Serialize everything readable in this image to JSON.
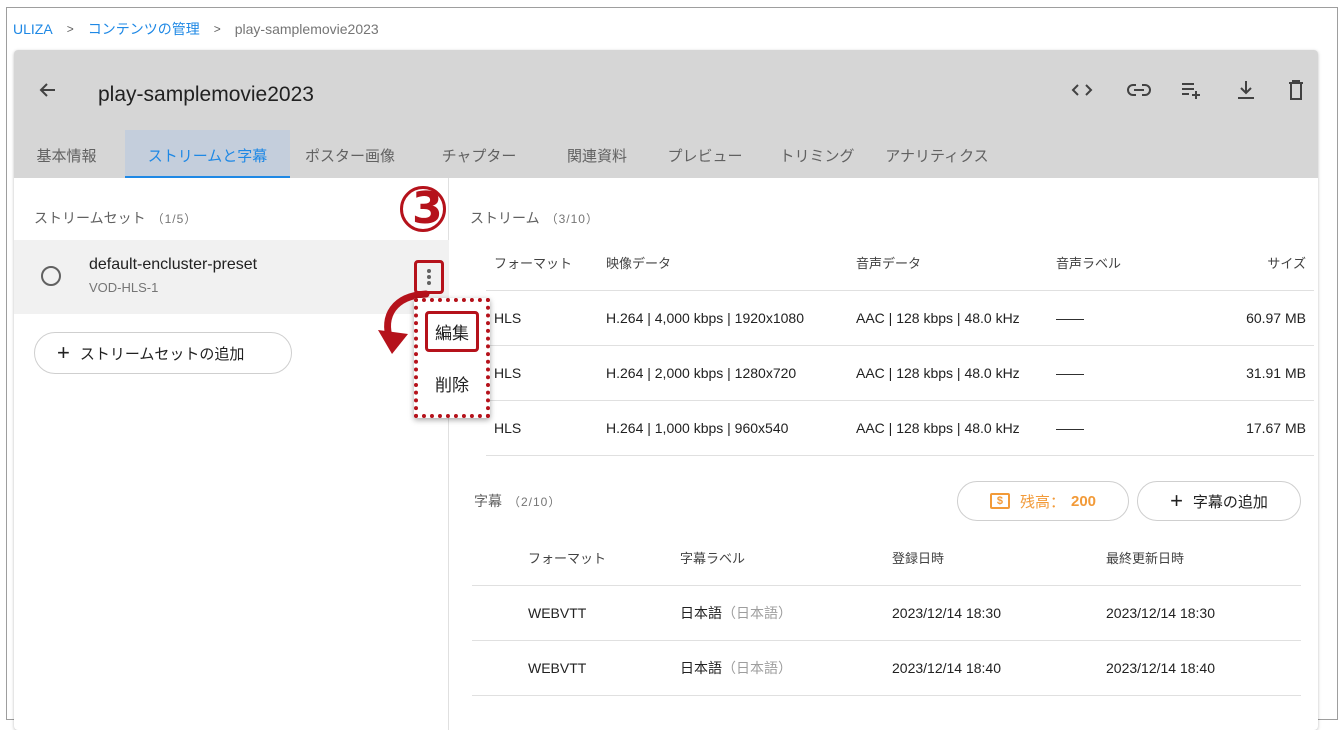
{
  "breadcrumb": {
    "root": "ULIZA",
    "sep": ">",
    "section": "コンテンツの管理",
    "current": "play-samplemovie2023"
  },
  "header": {
    "title": "play-samplemovie2023",
    "back_icon": "arrow-left-icon",
    "actions": [
      "code-icon",
      "link-icon",
      "playlist-add-icon",
      "download-icon",
      "trash-icon"
    ]
  },
  "tabs": [
    {
      "label": "基本情報",
      "active": false
    },
    {
      "label": "ストリームと字幕",
      "active": true
    },
    {
      "label": "ポスター画像",
      "active": false
    },
    {
      "label": "チャプター",
      "active": false
    },
    {
      "label": "関連資料",
      "active": false
    },
    {
      "label": "プレビュー",
      "active": false
    },
    {
      "label": "トリミング",
      "active": false
    },
    {
      "label": "アナリティクス",
      "active": false
    }
  ],
  "stream_sets": {
    "title": "ストリームセット",
    "count": "（1/5）",
    "items": [
      {
        "name": "default-encluster-preset",
        "sub": "VOD-HLS-1"
      }
    ],
    "add_label": "ストリームセットの追加",
    "menu": {
      "edit": "編集",
      "delete": "削除"
    }
  },
  "annotation": {
    "step": "3",
    "color": "#b5121b"
  },
  "streams": {
    "title": "ストリーム",
    "count": "（3/10）",
    "columns": [
      "フォーマット",
      "映像データ",
      "音声データ",
      "音声ラベル",
      "サイズ"
    ],
    "rows": [
      {
        "format": "HLS",
        "video": "H.264 | 4,000 kbps | 1920x1080",
        "audio": "AAC | 128 kbps | 48.0 kHz",
        "label": "——",
        "size": "60.97 MB"
      },
      {
        "format": "HLS",
        "video": "H.264 | 2,000 kbps | 1280x720",
        "audio": "AAC | 128 kbps | 48.0 kHz",
        "label": "——",
        "size": "31.91 MB"
      },
      {
        "format": "HLS",
        "video": "H.264 | 1,000 kbps | 960x540",
        "audio": "AAC | 128 kbps | 48.0 kHz",
        "label": "——",
        "size": "17.67 MB"
      }
    ]
  },
  "captions": {
    "title": "字幕",
    "count": "（2/10）",
    "balance_label": "残高：",
    "balance_value": "200",
    "coin_symbol": "$",
    "add_label": "字幕の追加",
    "columns": [
      "フォーマット",
      "字幕ラベル",
      "登録日時",
      "最終更新日時"
    ],
    "rows": [
      {
        "format": "WEBVTT",
        "label": "日本語",
        "label_sub": "（日本語）",
        "created": "2023/12/14 18:30",
        "updated": "2023/12/14 18:30"
      },
      {
        "format": "WEBVTT",
        "label": "日本語",
        "label_sub": "（日本語）",
        "created": "2023/12/14 18:40",
        "updated": "2023/12/14 18:40"
      }
    ]
  },
  "colors": {
    "accent": "#1e88e5",
    "balance": "#f29a38",
    "header_bg": "#d6d6d6"
  }
}
